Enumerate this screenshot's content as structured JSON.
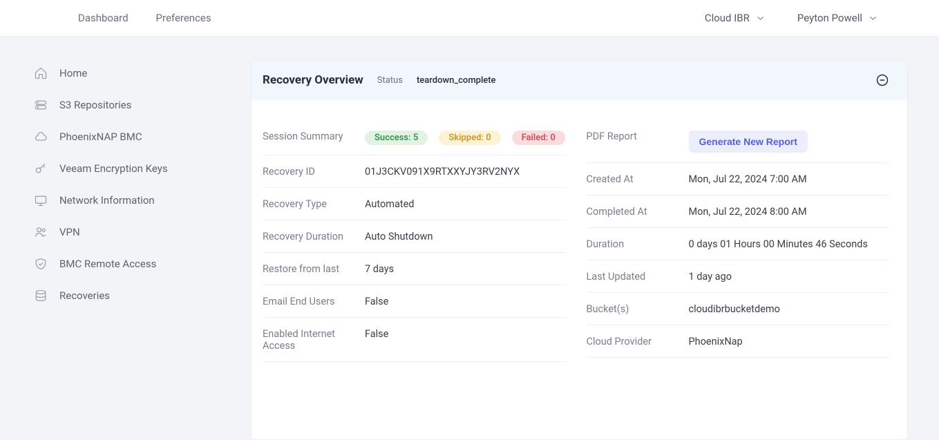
{
  "topNav": {
    "left": [
      "Dashboard",
      "Preferences"
    ],
    "right": [
      "Cloud IBR",
      "Peyton Powell"
    ]
  },
  "sidebar": {
    "items": [
      {
        "label": "Home"
      },
      {
        "label": "S3 Repositories"
      },
      {
        "label": "PhoenixNAP BMC"
      },
      {
        "label": "Veeam Encryption Keys"
      },
      {
        "label": "Network Information"
      },
      {
        "label": "VPN"
      },
      {
        "label": "BMC Remote Access"
      },
      {
        "label": "Recoveries"
      }
    ]
  },
  "panel": {
    "title": "Recovery Overview",
    "statusLabel": "Status",
    "statusValue": "teardown_complete"
  },
  "left": {
    "sessionSummaryLabel": "Session Summary",
    "successBadge": "Success: 5",
    "skippedBadge": "Skipped: 0",
    "failedBadge": "Failed: 0",
    "recoveryIdLabel": "Recovery ID",
    "recoveryIdValue": "01J3CKV091X9RTXXYJY3RV2NYX",
    "recoveryTypeLabel": "Recovery Type",
    "recoveryTypeValue": "Automated",
    "recoveryDurationLabel": "Recovery Duration",
    "recoveryDurationValue": "Auto Shutdown",
    "restoreFromLastLabel": "Restore from last",
    "restoreFromLastValue": "7 days",
    "emailEndUsersLabel": "Email End Users",
    "emailEndUsersValue": "False",
    "enabledInternetLabel": "Enabled Internet Access",
    "enabledInternetValue": "False"
  },
  "right": {
    "pdfReportLabel": "PDF Report",
    "generateBtn": "Generate New Report",
    "createdAtLabel": "Created At",
    "createdAtValue": "Mon, Jul 22, 2024 7:00 AM",
    "completedAtLabel": "Completed At",
    "completedAtValue": "Mon, Jul 22, 2024 8:00 AM",
    "durationLabel": "Duration",
    "durationValue": "0 days 01 Hours 00 Minutes 46 Seconds",
    "lastUpdatedLabel": "Last Updated",
    "lastUpdatedValue": "1 day ago",
    "bucketsLabel": "Bucket(s)",
    "bucketsValue": "cloudibrbucketdemo",
    "cloudProviderLabel": "Cloud Provider",
    "cloudProviderValue": "PhoenixNap"
  }
}
